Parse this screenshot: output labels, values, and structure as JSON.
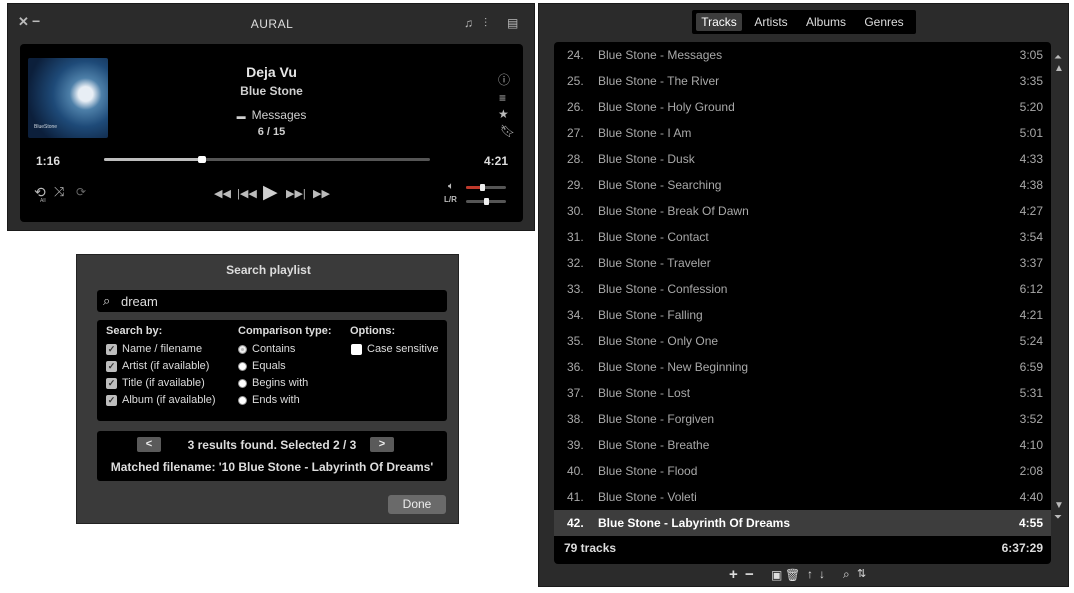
{
  "player": {
    "app_title": "AURAL",
    "track_title": "Deja Vu",
    "track_artist": "Blue Stone",
    "track_album": "Messages",
    "track_number": "6 / 15",
    "elapsed": "1:16",
    "duration": "4:21",
    "seek_fraction": 0.3,
    "volume_fraction": 0.4,
    "balance_label": "L/R",
    "repeat_badge": "All",
    "album_art_label": "BlueStone"
  },
  "search": {
    "title": "Search playlist",
    "query": "dream",
    "search_by_heading": "Search by:",
    "search_by": [
      {
        "label": "Name / filename",
        "checked": true
      },
      {
        "label": "Artist (if available)",
        "checked": true
      },
      {
        "label": "Title (if available)",
        "checked": true
      },
      {
        "label": "Album (if available)",
        "checked": true
      }
    ],
    "comparison_heading": "Comparison type:",
    "comparison": [
      {
        "label": "Contains",
        "selected": true
      },
      {
        "label": "Equals",
        "selected": false
      },
      {
        "label": "Begins with",
        "selected": false
      },
      {
        "label": "Ends with",
        "selected": false
      }
    ],
    "options_heading": "Options:",
    "case_sensitive_label": "Case sensitive",
    "case_sensitive": false,
    "prev_label": "<",
    "next_label": ">",
    "results_text": "3 results found. Selected 2 / 3",
    "matched_text": "Matched filename: '10 Blue Stone - Labyrinth Of Dreams'",
    "done_label": "Done"
  },
  "playlist": {
    "tabs": [
      "Tracks",
      "Artists",
      "Albums",
      "Genres"
    ],
    "active_tab": "Tracks",
    "tracks": [
      {
        "num": "24.",
        "title": "Blue Stone - Messages",
        "dur": "3:05"
      },
      {
        "num": "25.",
        "title": "Blue Stone - The River",
        "dur": "3:35"
      },
      {
        "num": "26.",
        "title": "Blue Stone - Holy Ground",
        "dur": "5:20"
      },
      {
        "num": "27.",
        "title": "Blue Stone - I Am",
        "dur": "5:01"
      },
      {
        "num": "28.",
        "title": "Blue Stone - Dusk",
        "dur": "4:33"
      },
      {
        "num": "29.",
        "title": "Blue Stone - Searching",
        "dur": "4:38"
      },
      {
        "num": "30.",
        "title": "Blue Stone - Break Of Dawn",
        "dur": "4:27"
      },
      {
        "num": "31.",
        "title": "Blue Stone - Contact",
        "dur": "3:54"
      },
      {
        "num": "32.",
        "title": "Blue Stone - Traveler",
        "dur": "3:37"
      },
      {
        "num": "33.",
        "title": "Blue Stone - Confession",
        "dur": "6:12"
      },
      {
        "num": "34.",
        "title": "Blue Stone - Falling",
        "dur": "4:21"
      },
      {
        "num": "35.",
        "title": "Blue Stone - Only One",
        "dur": "5:24"
      },
      {
        "num": "36.",
        "title": "Blue Stone - New Beginning",
        "dur": "6:59"
      },
      {
        "num": "37.",
        "title": "Blue Stone - Lost",
        "dur": "5:31"
      },
      {
        "num": "38.",
        "title": "Blue Stone - Forgiven",
        "dur": "3:52"
      },
      {
        "num": "39.",
        "title": "Blue Stone - Breathe",
        "dur": "4:10"
      },
      {
        "num": "40.",
        "title": "Blue Stone - Flood",
        "dur": "2:08"
      },
      {
        "num": "41.",
        "title": "Blue Stone - Voleti",
        "dur": "4:40"
      },
      {
        "num": "42.",
        "title": "Blue Stone - Labyrinth Of Dreams",
        "dur": "4:55",
        "selected": true
      }
    ],
    "summary_count": "79 tracks",
    "summary_duration": "6:37:29"
  },
  "colors": {
    "background": "#000000",
    "panel": "#2b2b2b",
    "text": "#dddddd",
    "selected_row": "#3d3d3d"
  }
}
